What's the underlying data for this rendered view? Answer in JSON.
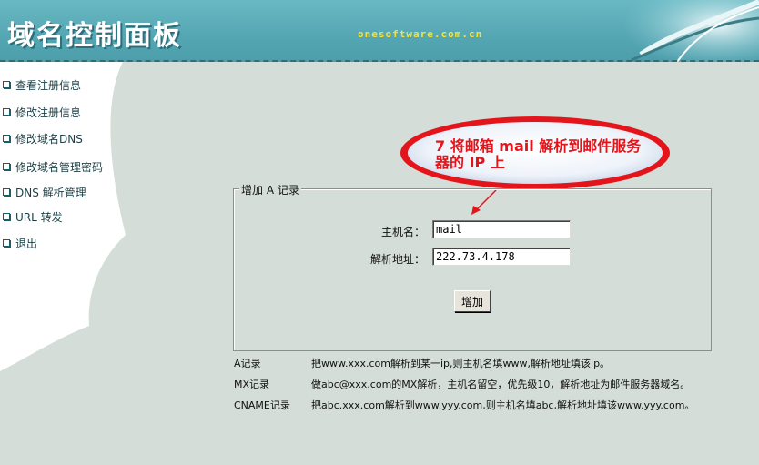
{
  "header": {
    "title": "域名控制面板",
    "site_url": "onesoftware.com.cn"
  },
  "sidebar": {
    "items": [
      {
        "label": "查看注册信息"
      },
      {
        "label": "修改注册信息"
      },
      {
        "label": "修改域名DNS"
      },
      {
        "label": "修改域名管理密码"
      },
      {
        "label": "DNS 解析管理"
      },
      {
        "label": "URL 转发"
      },
      {
        "label": "退出"
      }
    ]
  },
  "callout": {
    "line1": "7 将邮箱 mail 解析到邮件服务",
    "line2": "器的 IP 上"
  },
  "form": {
    "legend": "增加 A 记录",
    "host_label": "主机名：",
    "host_value": "mail",
    "address_label": "解析地址：",
    "address_value": "222.73.4.178",
    "submit_label": "增加"
  },
  "help": [
    {
      "type": "A记录",
      "desc": "把www.xxx.com解析到某一ip,则主机名填www,解析地址填该ip。"
    },
    {
      "type": "MX记录",
      "desc": "做abc@xxx.com的MX解析，主机名留空，优先级10，解析地址为邮件服务器域名。"
    },
    {
      "type": "CNAME记录",
      "desc": "把abc.xxx.com解析到www.yyy.com,则主机名填abc,解析地址填该www.yyy.com。"
    }
  ],
  "colors": {
    "header": "#5cadb9",
    "background": "#d4ddd8",
    "callout_text": "#e4141b",
    "url_text": "#f4e33a"
  }
}
